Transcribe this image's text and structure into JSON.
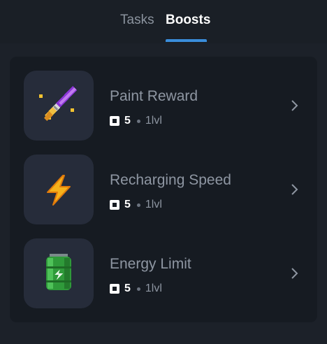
{
  "tabs": [
    {
      "label": "Tasks",
      "active": false
    },
    {
      "label": "Boosts",
      "active": true
    }
  ],
  "accent_color": "#3a8ddb",
  "boosts": [
    {
      "title": "Paint Reward",
      "cost": "5",
      "level": "1lvl",
      "icon": "paintbrush-icon"
    },
    {
      "title": "Recharging Speed",
      "cost": "5",
      "level": "1lvl",
      "icon": "lightning-icon"
    },
    {
      "title": "Energy Limit",
      "cost": "5",
      "level": "1lvl",
      "icon": "battery-icon"
    }
  ],
  "icons": {
    "coin": "coin-icon",
    "chevron": "chevron-right-icon"
  }
}
